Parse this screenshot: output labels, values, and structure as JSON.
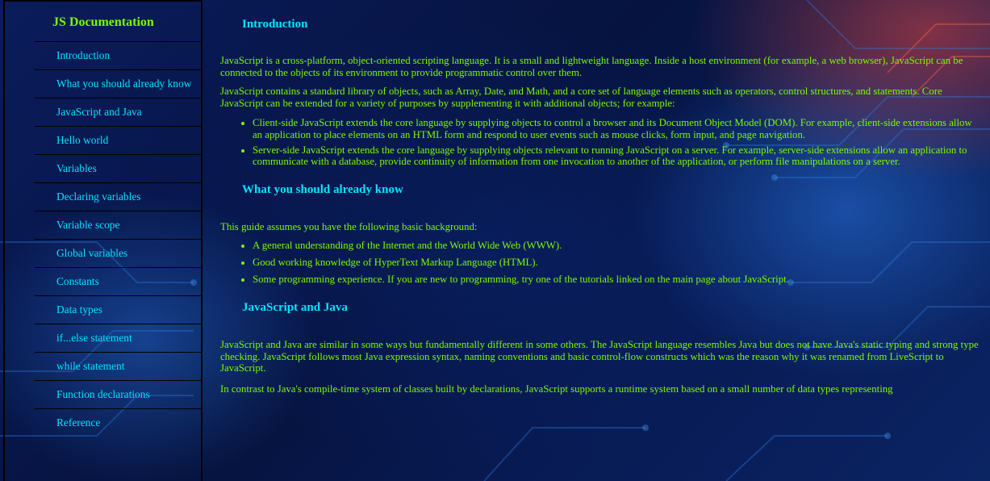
{
  "sidebar": {
    "title": "JS Documentation",
    "items": [
      {
        "label": "Introduction"
      },
      {
        "label": "What you should already know"
      },
      {
        "label": "JavaScript and Java"
      },
      {
        "label": "Hello world"
      },
      {
        "label": "Variables"
      },
      {
        "label": "Declaring variables"
      },
      {
        "label": "Variable scope"
      },
      {
        "label": "Global variables"
      },
      {
        "label": "Constants"
      },
      {
        "label": "Data types"
      },
      {
        "label": "if...else statement"
      },
      {
        "label": "while statement"
      },
      {
        "label": "Function declarations"
      },
      {
        "label": "Reference"
      }
    ]
  },
  "main": {
    "intro": {
      "title": "Introduction",
      "p1": "JavaScript is a cross-platform, object-oriented scripting language. It is a small and lightweight language. Inside a host environment (for example, a web browser), JavaScript can be connected to the objects of its environment to provide programmatic control over them.",
      "p2": "JavaScript contains a standard library of objects, such as Array, Date, and Math, and a core set of language elements such as operators, control structures, and statements. Core JavaScript can be extended for a variety of purposes by supplementing it with additional objects; for example:",
      "bullets": [
        "Client-side JavaScript extends the core language by supplying objects to control a browser and its Document Object Model (DOM). For example, client-side extensions allow an application to place elements on an HTML form and respond to user events such as mouse clicks, form input, and page navigation.",
        "Server-side JavaScript extends the core language by supplying objects relevant to running JavaScript on a server. For example, server-side extensions allow an application to communicate with a database, provide continuity of information from one invocation to another of the application, or perform file manipulations on a server."
      ]
    },
    "know": {
      "title": "What you should already know",
      "p1": "This guide assumes you have the following basic background:",
      "bullets": [
        "A general understanding of the Internet and the World Wide Web (WWW).",
        "Good working knowledge of HyperText Markup Language (HTML).",
        "Some programming experience. If you are new to programming, try one of the tutorials linked on the main page about JavaScript."
      ]
    },
    "java": {
      "title": "JavaScript and Java",
      "p1": "JavaScript and Java are similar in some ways but fundamentally different in some others. The JavaScript language resembles Java but does not have Java's static typing and strong type checking. JavaScript follows most Java expression syntax, naming conventions and basic control-flow constructs which was the reason why it was renamed from LiveScript to JavaScript.",
      "p2": "In contrast to Java's compile-time system of classes built by declarations, JavaScript supports a runtime system based on a small number of data types representing"
    }
  },
  "colors": {
    "text_green": "#7cfc00",
    "text_cyan": "#00e5ff",
    "background": "#071545"
  }
}
